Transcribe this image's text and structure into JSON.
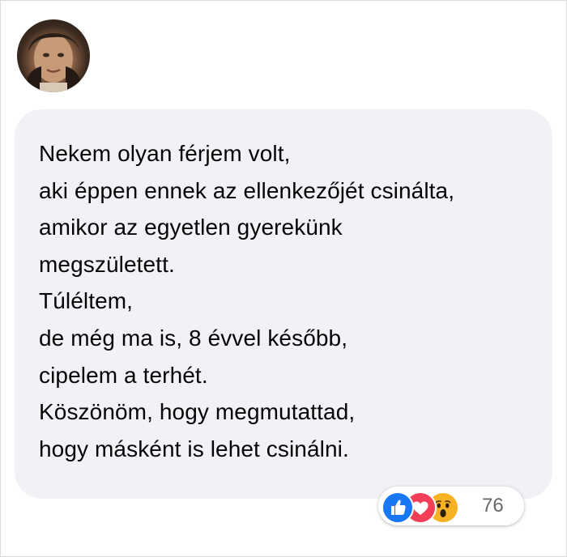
{
  "comment": {
    "lines": [
      "Nekem olyan férjem volt,",
      "aki éppen ennek az ellenkezőjét csinálta,",
      "amikor az egyetlen gyerekünk",
      "megszületett.",
      "Túléltem,",
      "de még ma is, 8 évvel később,",
      "cipelem a terhét.",
      "Köszönöm, hogy megmutattad,",
      "hogy másként is lehet csinálni."
    ]
  },
  "reactions": {
    "icons": [
      "like-icon",
      "love-icon",
      "wow-icon"
    ],
    "count": "76",
    "colors": {
      "like": "#1877f2",
      "love": "#f33e58",
      "wow": "#f7b125"
    }
  },
  "colors": {
    "bubble_background": "#f0f2f5",
    "text": "#050505",
    "count_text": "#65676b"
  }
}
